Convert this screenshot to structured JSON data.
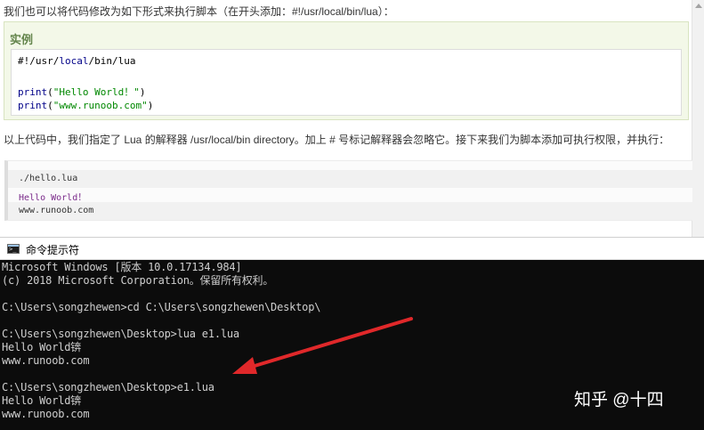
{
  "tutorial": {
    "intro": "我们也可以将代码修改为如下形式来执行脚本（在开头添加：#!/usr/local/bin/lua）：",
    "example_title": "实例",
    "code": {
      "shebang_a": "#!/usr/",
      "shebang_kw": "local",
      "shebang_b": "/bin/lua",
      "print_kw": "print",
      "line2_open": "(",
      "line2_str": "\"Hello World！\"",
      "line2_close": ")",
      "line3_open": "(",
      "line3_str": "\"www.runoob.com\"",
      "line3_close": ")"
    },
    "description": "以上代码中，我们指定了 Lua 的解释器 /usr/local/bin directory。加上 # 号标记解释器会忽略它。接下来我们为脚本添加可执行权限，并执行：",
    "output": [
      "./hello.lua",
      "Hello World！",
      "www.runoob.com"
    ]
  },
  "cmd": {
    "title": "命令提示符",
    "lines": [
      "Microsoft Windows [版本 10.0.17134.984]",
      "(c) 2018 Microsoft Corporation。保留所有权利。",
      "",
      "C:\\Users\\songzhewen>cd C:\\Users\\songzhewen\\Desktop\\",
      "",
      "C:\\Users\\songzhewen\\Desktop>lua e1.lua",
      "Hello World锛",
      "www.runoob.com",
      "",
      "C:\\Users\\songzhewen\\Desktop>e1.lua",
      "Hello World锛",
      "www.runoob.com"
    ]
  },
  "watermark": "知乎 @十四",
  "colors": {
    "annotation_arrow": "#e0282a",
    "example_title": "#64854c",
    "console_bg": "#0c0c0c"
  }
}
